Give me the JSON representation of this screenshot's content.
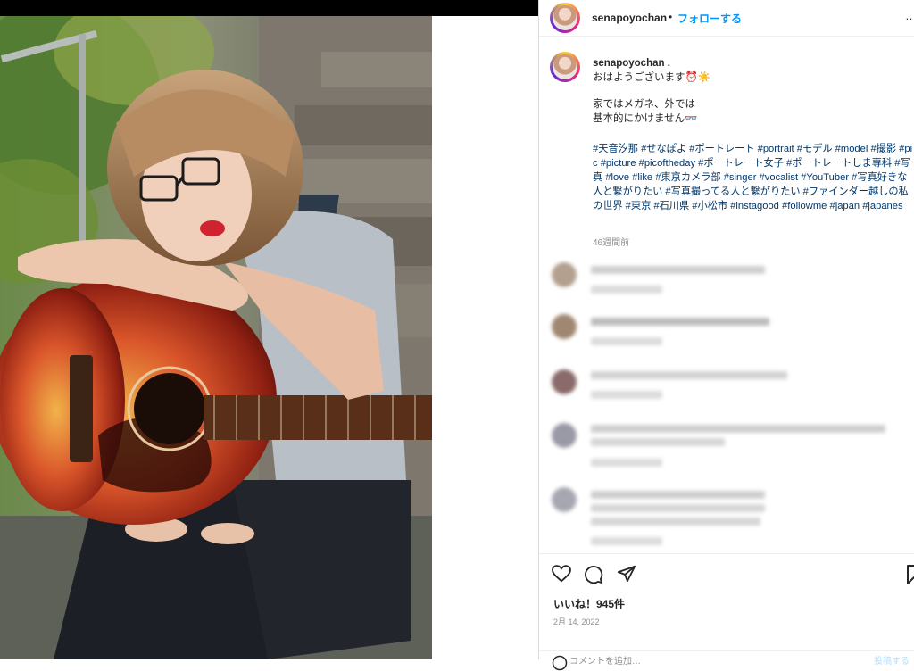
{
  "post": {
    "username": "senapoyochan",
    "separator": "•",
    "follow_label": "フォローする",
    "more_label": "…"
  },
  "caption": {
    "username": "senapoyochan .",
    "greeting": "おはようございます⏰☀️",
    "line1": "家ではメガネ、外では",
    "line2": "基本的にかけません👓",
    "hashtags": "#天音汐那 #せなぽよ #ポートレート #portrait #モデル #model #撮影 #pic #picture #picoftheday #ポートレート女子 #ポートレートしま専科 #写真 #love #like #東京カメラ部 #singer #vocalist #YouTuber #写真好きな人と繋がりたい #写真撮ってる人と繋がりたい #ファインダー越しの私の世界 #東京 #石川県 #小松市 #instagood #followme #japan #japanes",
    "time_ago": "46週間前"
  },
  "actions": {
    "likes": "いいね！945件",
    "date": "2月 14, 2022",
    "add_comment_placeholder": "コメントを追加…",
    "post_label": "投稿する",
    "icons": [
      "heart-icon",
      "comment-icon",
      "share-icon",
      "bookmark-icon"
    ]
  },
  "colors": {
    "accent": "#0095f6",
    "hashtag": "#00376b",
    "muted": "#8e8e8e"
  }
}
